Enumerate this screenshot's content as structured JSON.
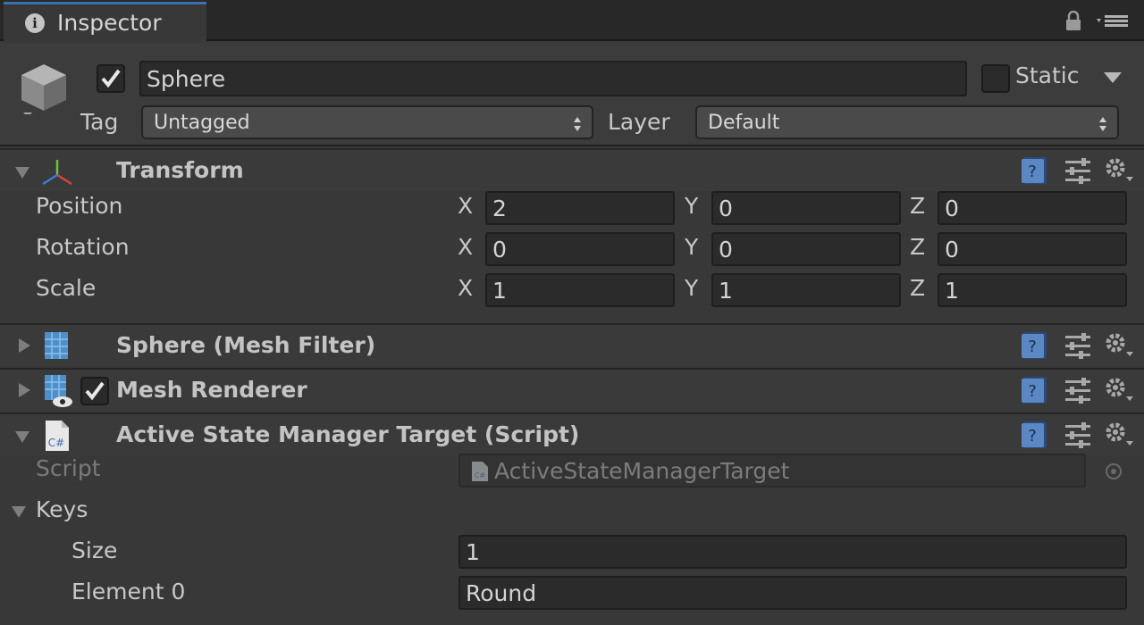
{
  "window": {
    "tab_title": "Inspector"
  },
  "gameobject": {
    "active": true,
    "name": "Sphere",
    "static_label": "Static",
    "static_checked": false,
    "tag_label": "Tag",
    "tag_value": "Untagged",
    "layer_label": "Layer",
    "layer_value": "Default"
  },
  "transform": {
    "title": "Transform",
    "rows": [
      {
        "label": "Position",
        "x": "2",
        "y": "0",
        "z": "0"
      },
      {
        "label": "Rotation",
        "x": "0",
        "y": "0",
        "z": "0"
      },
      {
        "label": "Scale",
        "x": "1",
        "y": "1",
        "z": "1"
      }
    ],
    "axes": {
      "x": "X",
      "y": "Y",
      "z": "Z"
    }
  },
  "mesh_filter": {
    "title": "Sphere (Mesh Filter)"
  },
  "mesh_renderer": {
    "title": "Mesh Renderer",
    "enabled": true
  },
  "script_component": {
    "title": "Active State Manager Target (Script)",
    "script_label": "Script",
    "script_value": "ActiveStateManagerTarget",
    "keys_label": "Keys",
    "size_label": "Size",
    "size_value": "1",
    "element0_label": "Element 0",
    "element0_value": "Round"
  },
  "icons": {
    "tab": "info-icon",
    "lock": "lock-icon",
    "menu": "menu-icon",
    "gameobject": "cube-icon",
    "transform": "transform-axes-icon",
    "mesh_filter": "mesh-filter-icon",
    "mesh_renderer": "mesh-renderer-icon",
    "script": "csharp-script-icon",
    "help": "help-icon",
    "preset": "preset-icon",
    "gear": "gear-icon"
  },
  "colors": {
    "accent_tab": "#3a72b0",
    "background": "#383838",
    "field": "#2b2b2b"
  }
}
